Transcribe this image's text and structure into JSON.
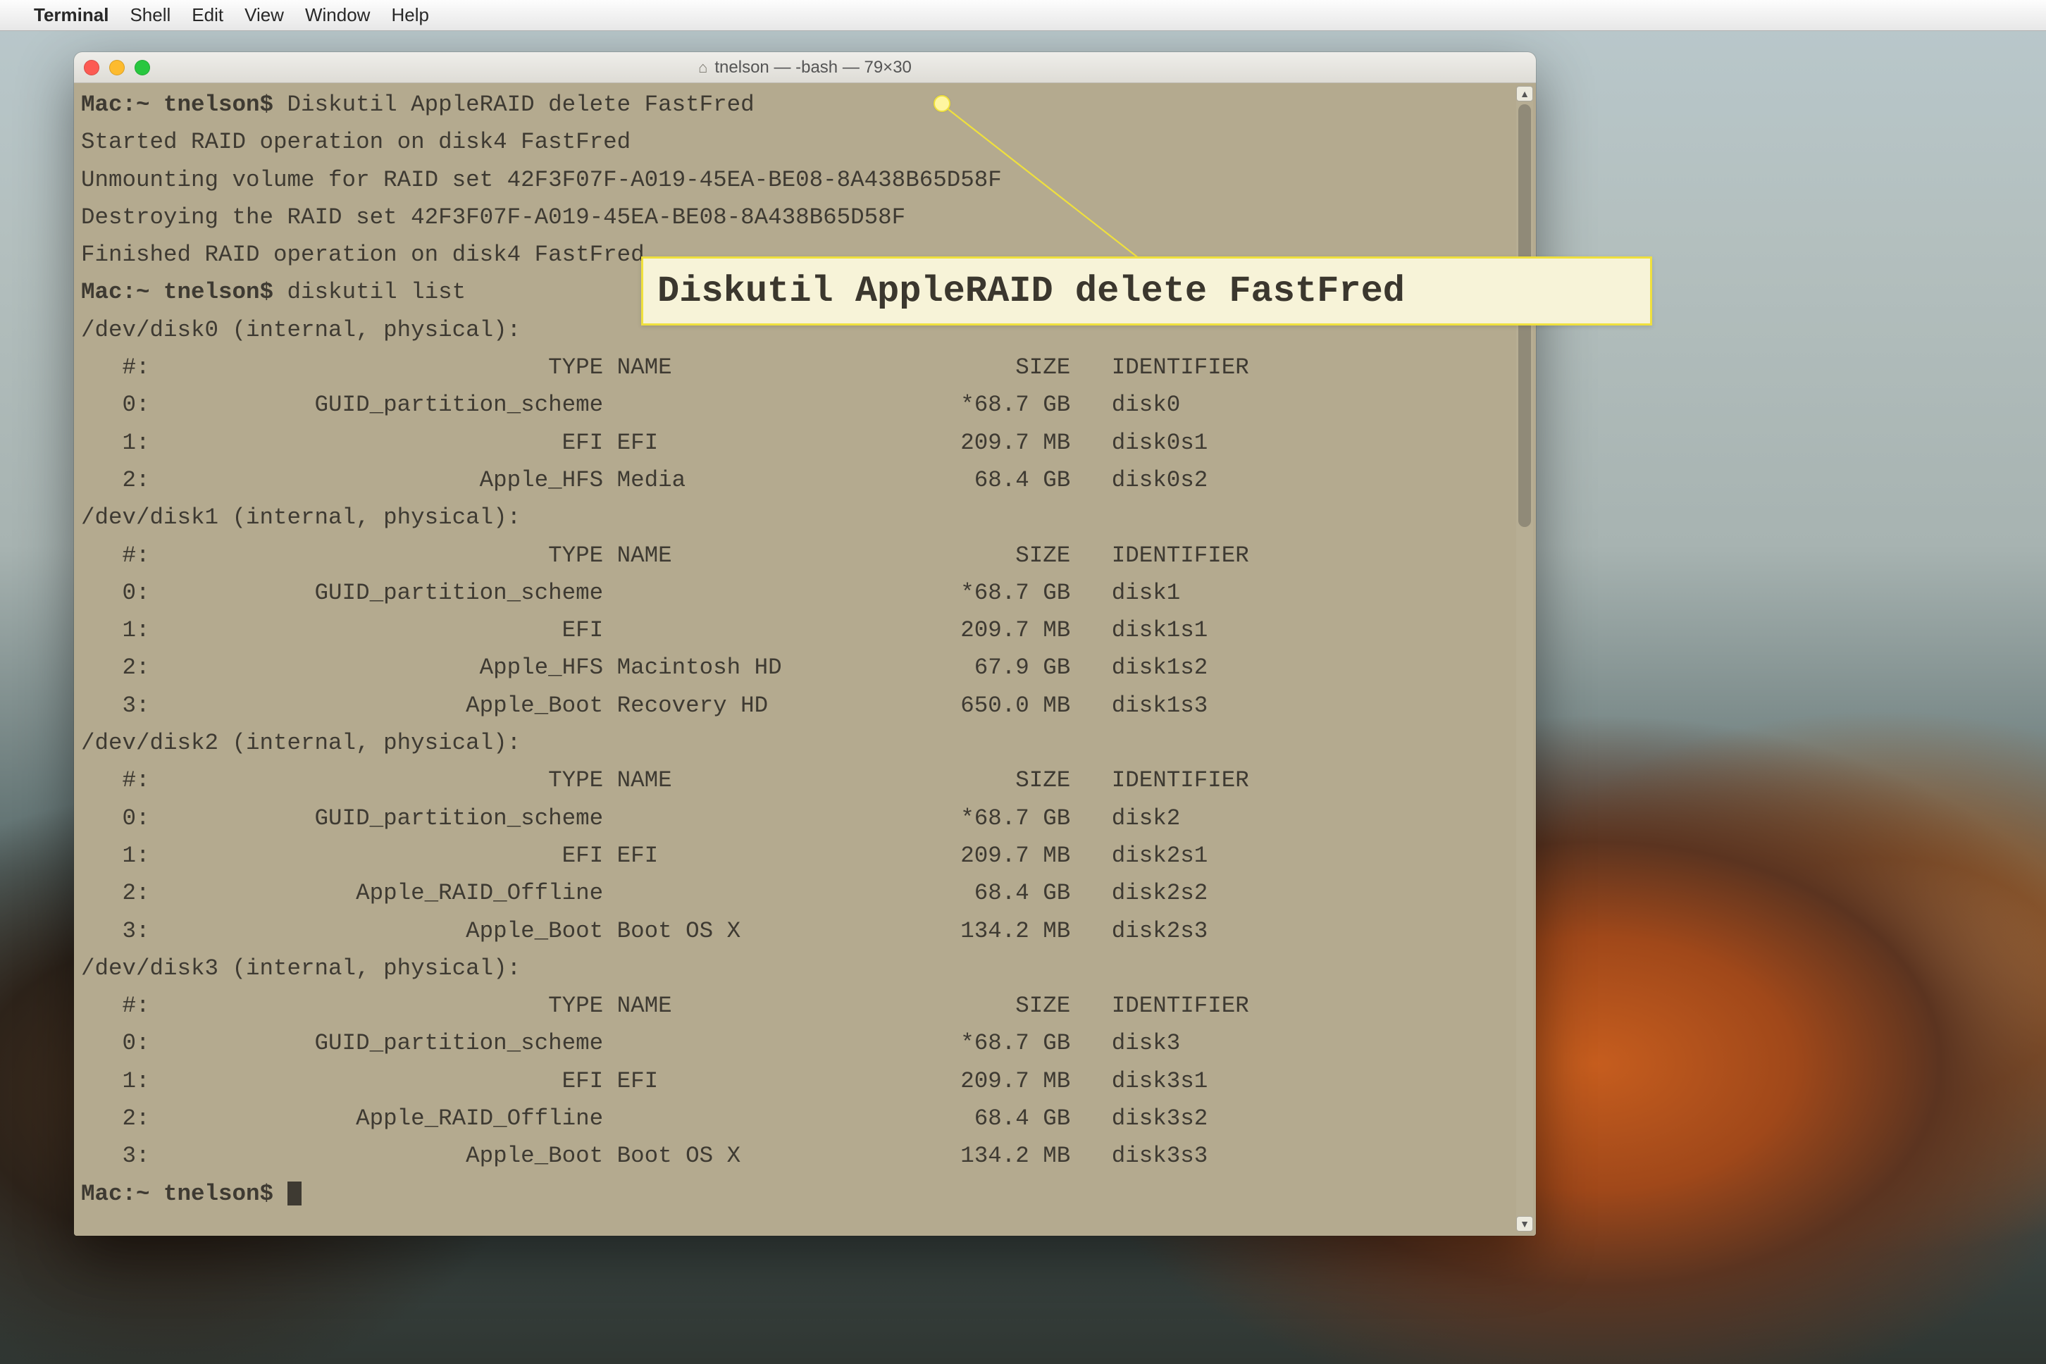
{
  "menubar": {
    "app": "Terminal",
    "items": [
      "Shell",
      "Edit",
      "View",
      "Window",
      "Help"
    ]
  },
  "window": {
    "title": "tnelson — -bash — 79×30"
  },
  "callout": {
    "text": "Diskutil AppleRAID delete FastFred"
  },
  "terminal": {
    "prompt_host": "Mac:~ tnelson$",
    "lines": [
      {
        "kind": "cmd",
        "prompt": "Mac:~ tnelson$",
        "text": " Diskutil AppleRAID delete FastFred"
      },
      {
        "kind": "out",
        "text": "Started RAID operation on disk4 FastFred"
      },
      {
        "kind": "out",
        "text": "Unmounting volume for RAID set 42F3F07F-A019-45EA-BE08-8A438B65D58F"
      },
      {
        "kind": "out",
        "text": "Destroying the RAID set 42F3F07F-A019-45EA-BE08-8A438B65D58F"
      },
      {
        "kind": "out",
        "text": "Finished RAID operation on disk4 FastFred"
      },
      {
        "kind": "cmd",
        "prompt": "Mac:~ tnelson$",
        "text": " diskutil list"
      }
    ],
    "disk_header": {
      "num": "#:",
      "type": "TYPE",
      "name": "NAME",
      "size": "SIZE",
      "id": "IDENTIFIER"
    },
    "disks": [
      {
        "device": "/dev/disk0 (internal, physical):",
        "parts": [
          {
            "num": "0:",
            "type": "GUID_partition_scheme",
            "name": "",
            "size": "*68.7 GB",
            "id": "disk0"
          },
          {
            "num": "1:",
            "type": "EFI",
            "name": "EFI",
            "size": "209.7 MB",
            "id": "disk0s1"
          },
          {
            "num": "2:",
            "type": "Apple_HFS",
            "name": "Media",
            "size": "68.4 GB",
            "id": "disk0s2"
          }
        ]
      },
      {
        "device": "/dev/disk1 (internal, physical):",
        "parts": [
          {
            "num": "0:",
            "type": "GUID_partition_scheme",
            "name": "",
            "size": "*68.7 GB",
            "id": "disk1"
          },
          {
            "num": "1:",
            "type": "EFI",
            "name": "",
            "size": "209.7 MB",
            "id": "disk1s1"
          },
          {
            "num": "2:",
            "type": "Apple_HFS",
            "name": "Macintosh HD",
            "size": "67.9 GB",
            "id": "disk1s2"
          },
          {
            "num": "3:",
            "type": "Apple_Boot",
            "name": "Recovery HD",
            "size": "650.0 MB",
            "id": "disk1s3"
          }
        ]
      },
      {
        "device": "/dev/disk2 (internal, physical):",
        "parts": [
          {
            "num": "0:",
            "type": "GUID_partition_scheme",
            "name": "",
            "size": "*68.7 GB",
            "id": "disk2"
          },
          {
            "num": "1:",
            "type": "EFI",
            "name": "EFI",
            "size": "209.7 MB",
            "id": "disk2s1"
          },
          {
            "num": "2:",
            "type": "Apple_RAID_Offline",
            "name": "",
            "size": "68.4 GB",
            "id": "disk2s2"
          },
          {
            "num": "3:",
            "type": "Apple_Boot",
            "name": "Boot OS X",
            "size": "134.2 MB",
            "id": "disk2s3"
          }
        ]
      },
      {
        "device": "/dev/disk3 (internal, physical):",
        "parts": [
          {
            "num": "0:",
            "type": "GUID_partition_scheme",
            "name": "",
            "size": "*68.7 GB",
            "id": "disk3"
          },
          {
            "num": "1:",
            "type": "EFI",
            "name": "EFI",
            "size": "209.7 MB",
            "id": "disk3s1"
          },
          {
            "num": "2:",
            "type": "Apple_RAID_Offline",
            "name": "",
            "size": "68.4 GB",
            "id": "disk3s2"
          },
          {
            "num": "3:",
            "type": "Apple_Boot",
            "name": "Boot OS X",
            "size": "134.2 MB",
            "id": "disk3s3"
          }
        ]
      }
    ],
    "final_prompt": "Mac:~ tnelson$ "
  }
}
